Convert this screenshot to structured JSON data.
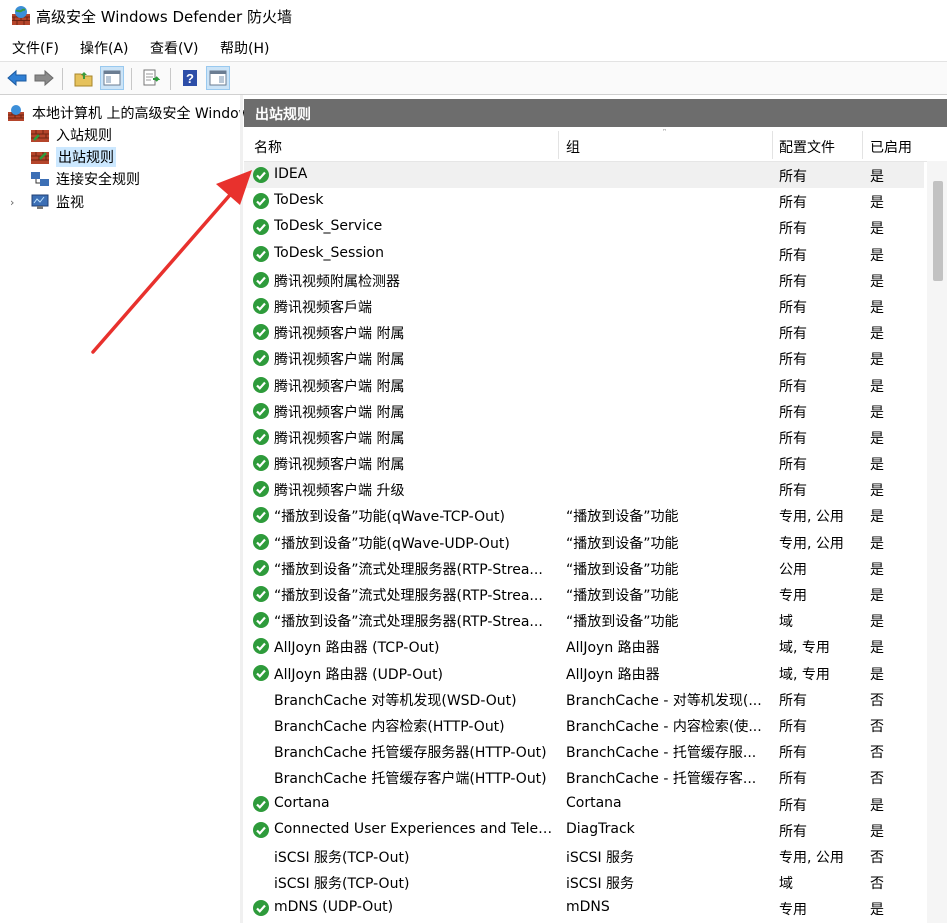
{
  "window": {
    "title": "高级安全 Windows Defender 防火墙",
    "app_icon": "firewall-icon"
  },
  "menu": [
    "文件(F)",
    "操作(A)",
    "查看(V)",
    "帮助(H)"
  ],
  "toolbar": {
    "icons": [
      "back-arrow-icon",
      "forward-arrow-icon",
      "up-folder-icon",
      "show-hide-console-tree-icon",
      "export-list-icon",
      "help-icon",
      "show-hide-action-pane-icon"
    ]
  },
  "tree": {
    "root_label": "本地计算机 上的高级安全 Windows Defender 防火墙",
    "items": [
      {
        "label": "入站规则",
        "icon": "inbound-rules-icon"
      },
      {
        "label": "出站规则",
        "icon": "outbound-rules-icon",
        "selected": true
      },
      {
        "label": "连接安全规则",
        "icon": "connection-security-icon"
      },
      {
        "label": "监视",
        "icon": "monitoring-icon"
      }
    ]
  },
  "panel": {
    "title": "出站规则"
  },
  "columns": {
    "name": "名称",
    "group": "组",
    "profile": "配置文件",
    "enabled": "已启用"
  },
  "colors": {
    "enabled_green": "#2e9b3b",
    "header_gray": "#6d6d6d",
    "selection_blue": "#cce8ff",
    "annotation_red": "#e8312d"
  },
  "annotation": {
    "type": "red-arrow",
    "points_to": "IDEA"
  },
  "rows": [
    {
      "name": "IDEA",
      "group": "",
      "profile": "所有",
      "enabled": "是",
      "state": "enabled"
    },
    {
      "name": "ToDesk",
      "group": "",
      "profile": "所有",
      "enabled": "是",
      "state": "enabled"
    },
    {
      "name": "ToDesk_Service",
      "group": "",
      "profile": "所有",
      "enabled": "是",
      "state": "enabled"
    },
    {
      "name": "ToDesk_Session",
      "group": "",
      "profile": "所有",
      "enabled": "是",
      "state": "enabled"
    },
    {
      "name": "腾讯视频附属检测器",
      "group": "",
      "profile": "所有",
      "enabled": "是",
      "state": "enabled"
    },
    {
      "name": "腾讯视频客戶端",
      "group": "",
      "profile": "所有",
      "enabled": "是",
      "state": "enabled"
    },
    {
      "name": "腾讯视频客户端 附属",
      "group": "",
      "profile": "所有",
      "enabled": "是",
      "state": "enabled"
    },
    {
      "name": "腾讯视频客户端 附属",
      "group": "",
      "profile": "所有",
      "enabled": "是",
      "state": "enabled"
    },
    {
      "name": "腾讯视频客户端 附属",
      "group": "",
      "profile": "所有",
      "enabled": "是",
      "state": "enabled"
    },
    {
      "name": "腾讯视频客户端 附属",
      "group": "",
      "profile": "所有",
      "enabled": "是",
      "state": "enabled"
    },
    {
      "name": "腾讯视频客户端 附属",
      "group": "",
      "profile": "所有",
      "enabled": "是",
      "state": "enabled"
    },
    {
      "name": "腾讯视频客户端 附属",
      "group": "",
      "profile": "所有",
      "enabled": "是",
      "state": "enabled"
    },
    {
      "name": "腾讯视频客户端 升级",
      "group": "",
      "profile": "所有",
      "enabled": "是",
      "state": "enabled"
    },
    {
      "name": "“播放到设备”功能(qWave-TCP-Out)",
      "group": "“播放到设备”功能",
      "profile": "专用, 公用",
      "enabled": "是",
      "state": "enabled"
    },
    {
      "name": "“播放到设备”功能(qWave-UDP-Out)",
      "group": "“播放到设备”功能",
      "profile": "专用, 公用",
      "enabled": "是",
      "state": "enabled"
    },
    {
      "name": "“播放到设备”流式处理服务器(RTP-Strea...",
      "group": "“播放到设备”功能",
      "profile": "公用",
      "enabled": "是",
      "state": "enabled"
    },
    {
      "name": "“播放到设备”流式处理服务器(RTP-Strea...",
      "group": "“播放到设备”功能",
      "profile": "专用",
      "enabled": "是",
      "state": "enabled"
    },
    {
      "name": "“播放到设备”流式处理服务器(RTP-Strea...",
      "group": "“播放到设备”功能",
      "profile": "域",
      "enabled": "是",
      "state": "enabled"
    },
    {
      "name": "AllJoyn 路由器 (TCP-Out)",
      "group": "AllJoyn 路由器",
      "profile": "域, 专用",
      "enabled": "是",
      "state": "enabled"
    },
    {
      "name": "AllJoyn 路由器 (UDP-Out)",
      "group": "AllJoyn 路由器",
      "profile": "域, 专用",
      "enabled": "是",
      "state": "enabled"
    },
    {
      "name": "BranchCache 对等机发现(WSD-Out)",
      "group": "BranchCache - 对等机发现(...",
      "profile": "所有",
      "enabled": "否",
      "state": "disabled"
    },
    {
      "name": "BranchCache 内容检索(HTTP-Out)",
      "group": "BranchCache - 内容检索(使...",
      "profile": "所有",
      "enabled": "否",
      "state": "disabled"
    },
    {
      "name": "BranchCache 托管缓存服务器(HTTP-Out)",
      "group": "BranchCache - 托管缓存服...",
      "profile": "所有",
      "enabled": "否",
      "state": "disabled"
    },
    {
      "name": "BranchCache 托管缓存客户端(HTTP-Out)",
      "group": "BranchCache - 托管缓存客...",
      "profile": "所有",
      "enabled": "否",
      "state": "disabled"
    },
    {
      "name": "Cortana",
      "group": "Cortana",
      "profile": "所有",
      "enabled": "是",
      "state": "enabled"
    },
    {
      "name": "Connected User Experiences and Telem...",
      "group": "DiagTrack",
      "profile": "所有",
      "enabled": "是",
      "state": "enabled"
    },
    {
      "name": "iSCSI 服务(TCP-Out)",
      "group": "iSCSI 服务",
      "profile": "专用, 公用",
      "enabled": "否",
      "state": "disabled"
    },
    {
      "name": "iSCSI 服务(TCP-Out)",
      "group": "iSCSI 服务",
      "profile": "域",
      "enabled": "否",
      "state": "disabled"
    },
    {
      "name": "mDNS (UDP-Out)",
      "group": "mDNS",
      "profile": "专用",
      "enabled": "是",
      "state": "enabled"
    }
  ]
}
